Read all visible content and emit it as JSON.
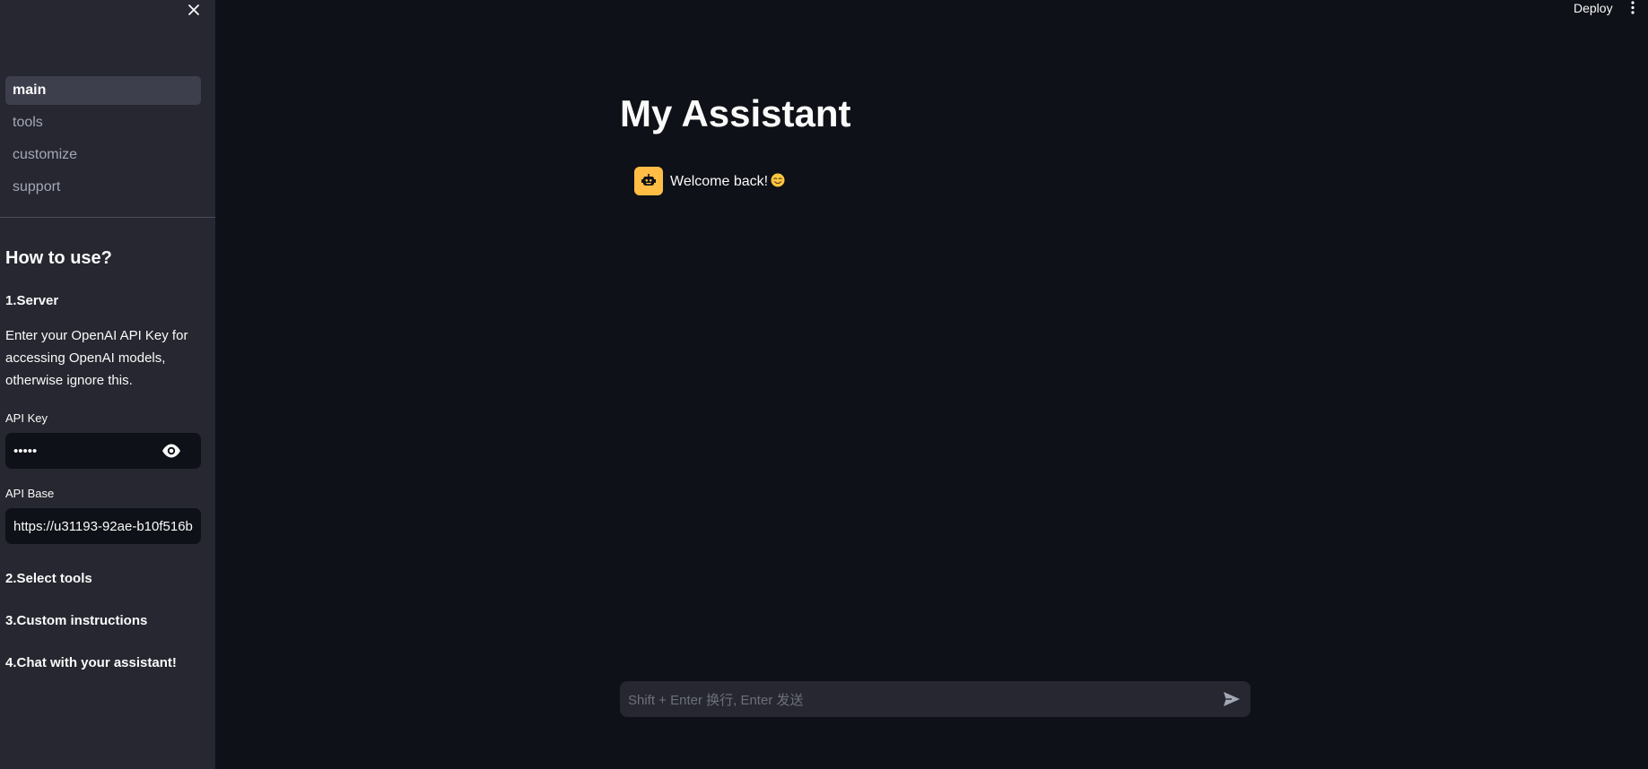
{
  "header": {
    "deploy_label": "Deploy"
  },
  "sidebar": {
    "nav": [
      {
        "label": "main",
        "active": true
      },
      {
        "label": "tools",
        "active": false
      },
      {
        "label": "customize",
        "active": false
      },
      {
        "label": "support",
        "active": false
      }
    ],
    "help_title": "How to use?",
    "step1_title": "1.Server",
    "step1_text": "Enter your OpenAI API Key for accessing OpenAI models, otherwise ignore this.",
    "api_key_label": "API Key",
    "api_key_value": "•••••",
    "api_base_label": "API Base",
    "api_base_value": "https://u31193-92ae-b10f516b",
    "step2_title": "2.Select tools",
    "step3_title": "3.Custom instructions",
    "step4_title": "4.Chat with your assistant!"
  },
  "main": {
    "title": "My Assistant",
    "messages": [
      {
        "role": "assistant",
        "text": "Welcome back!",
        "emoji": "smiling-face-emoji"
      }
    ],
    "chat_input_placeholder": "Shift + Enter 换行, Enter 发送"
  },
  "colors": {
    "background": "#0e1117",
    "sidebar": "#262730",
    "avatar": "#ffbd45",
    "text": "#fafafa"
  },
  "icons": {
    "close": "close-icon",
    "eye": "eye-icon",
    "menu": "more-vertical-icon",
    "bot": "robot-icon",
    "send": "send-icon"
  }
}
